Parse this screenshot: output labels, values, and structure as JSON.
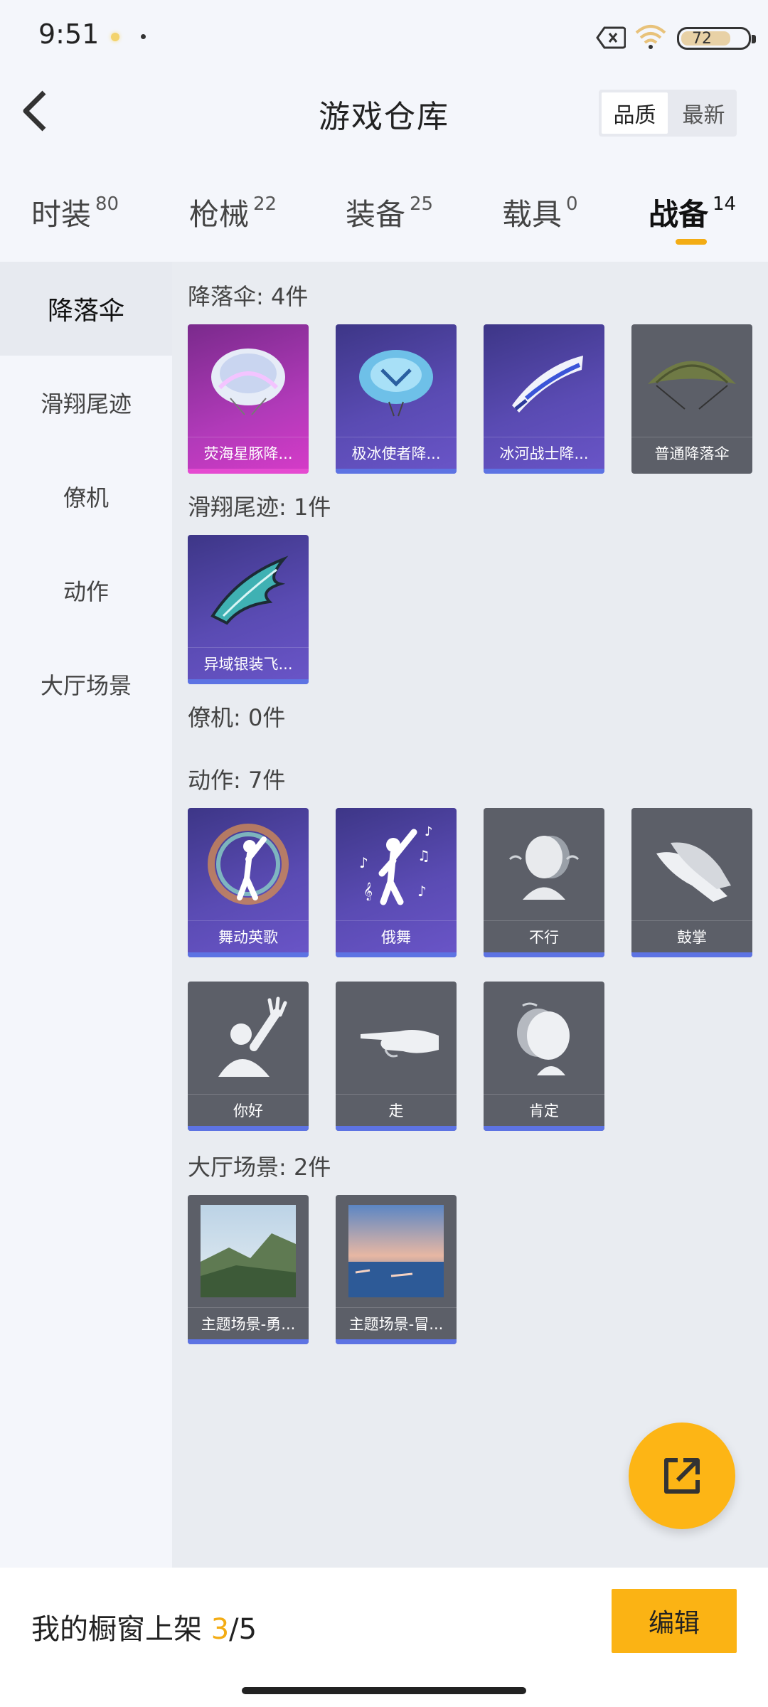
{
  "status": {
    "time": "9:51",
    "battery": "72"
  },
  "header": {
    "title": "游戏仓库",
    "sort_quality": "品质",
    "sort_newest": "最新"
  },
  "tabs": [
    {
      "label": "时装",
      "count": "80"
    },
    {
      "label": "枪械",
      "count": "22"
    },
    {
      "label": "装备",
      "count": "25"
    },
    {
      "label": "载具",
      "count": "0"
    },
    {
      "label": "战备",
      "count": "14"
    }
  ],
  "sidebar": [
    {
      "label": "降落伞"
    },
    {
      "label": "滑翔尾迹"
    },
    {
      "label": "僚机"
    },
    {
      "label": "动作"
    },
    {
      "label": "大厅场景"
    }
  ],
  "sections": {
    "parachute": {
      "title": "降落伞: 4件",
      "items": [
        {
          "name": "荧海星豚降...",
          "rarity": "pink",
          "icon": "parachute-jellyfish-icon"
        },
        {
          "name": "极冰使者降...",
          "rarity": "purple",
          "icon": "parachute-ice-icon"
        },
        {
          "name": "冰河战士降...",
          "rarity": "purple",
          "icon": "parachute-glider-icon"
        },
        {
          "name": "普通降落伞",
          "rarity": "grey",
          "icon": "parachute-basic-icon"
        }
      ]
    },
    "trail": {
      "title": "滑翔尾迹: 1件",
      "items": [
        {
          "name": "异域银装飞...",
          "rarity": "purple",
          "icon": "trail-wing-icon"
        }
      ]
    },
    "wingman": {
      "title": "僚机: 0件"
    },
    "emote": {
      "title": "动作: 7件",
      "items": [
        {
          "name": "舞动英歌",
          "rarity": "purple",
          "icon": "dance-emote-icon"
        },
        {
          "name": "俄舞",
          "rarity": "purple",
          "icon": "russian-dance-emote-icon"
        },
        {
          "name": "不行",
          "rarity": "grey",
          "icon": "head-shake-emote-icon"
        },
        {
          "name": "鼓掌",
          "rarity": "grey",
          "icon": "clap-emote-icon"
        },
        {
          "name": "你好",
          "rarity": "grey",
          "icon": "wave-emote-icon"
        },
        {
          "name": "走",
          "rarity": "grey",
          "icon": "point-emote-icon"
        },
        {
          "name": "肯定",
          "rarity": "grey",
          "icon": "nod-emote-icon"
        }
      ]
    },
    "lobby": {
      "title": "大厅场景: 2件",
      "items": [
        {
          "name": "主题场景-勇...",
          "rarity": "grey",
          "icon": "mountain-scene-icon"
        },
        {
          "name": "主题场景-冒...",
          "rarity": "grey",
          "icon": "sea-scene-icon"
        }
      ]
    }
  },
  "bottom": {
    "showcase_label": "我的橱窗上架 ",
    "showcase_current": "3",
    "showcase_total": "/5",
    "edit_label": "编辑"
  },
  "colors": {
    "accent": "#f3ac14",
    "rarity_purple": "#5a4bb3",
    "rarity_pink": "#d63bc8",
    "bar_blue": "#5d73e3"
  }
}
